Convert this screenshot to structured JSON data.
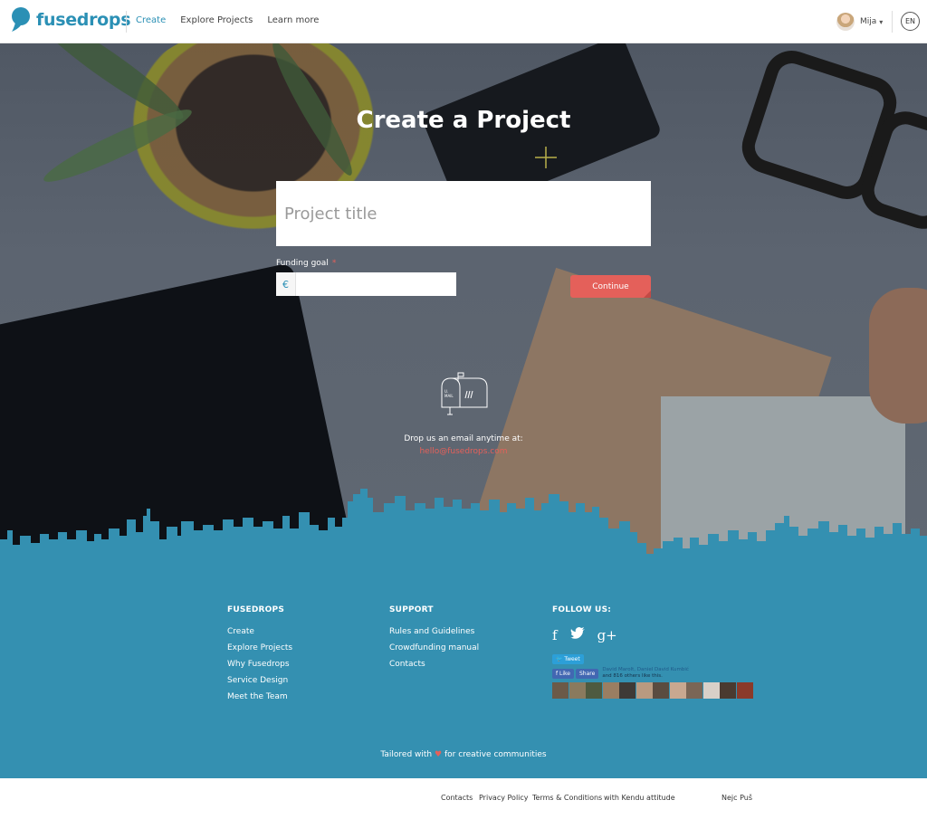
{
  "header": {
    "logo_text": "fusedrops",
    "nav": [
      {
        "label": "Create",
        "active": true
      },
      {
        "label": "Explore Projects"
      },
      {
        "label": "Learn more"
      }
    ],
    "user_name": "Mija",
    "language": "EN"
  },
  "hero": {
    "title_light": "Create a",
    "title_bold": "Project",
    "title_placeholder": "Project title",
    "funding_label": "Funding goal",
    "required_marker": "*",
    "currency_symbol": "€",
    "continue_label": "Continue",
    "contact_text": "Drop us an email anytime at:",
    "contact_email": "hello@fusedrops.com"
  },
  "footer": {
    "col1": {
      "title": "FUSEDROPS",
      "links": [
        "Create",
        "Explore Projects",
        "Why Fusedrops",
        "Service Design",
        "Meet the Team"
      ]
    },
    "col2": {
      "title": "SUPPORT",
      "links": [
        "Rules and Guidelines",
        "Crowdfunding manual",
        "Contacts"
      ]
    },
    "col3": {
      "title": "FOLLOW US:",
      "social_icons": [
        "facebook-icon",
        "twitter-icon",
        "google-plus-icon"
      ],
      "tweet_label": "Tweet",
      "fb_like_label": "Like",
      "fb_share_label": "Share",
      "fb_names": "David Marolt, Daniel David Kumbić",
      "fb_count_text": "and 816 others like this."
    },
    "tailored_prefix": "Tailored with",
    "tailored_suffix": "for creative communities"
  },
  "bottom_bar": {
    "links": [
      "Contacts",
      "Privacy Policy",
      "Terms & Conditions",
      "with Kendu attitude"
    ],
    "credit": "Nejc Puš"
  },
  "colors": {
    "brand_blue": "#2b90b5",
    "footer_blue": "#3490b1",
    "accent_red": "#e4605a"
  }
}
